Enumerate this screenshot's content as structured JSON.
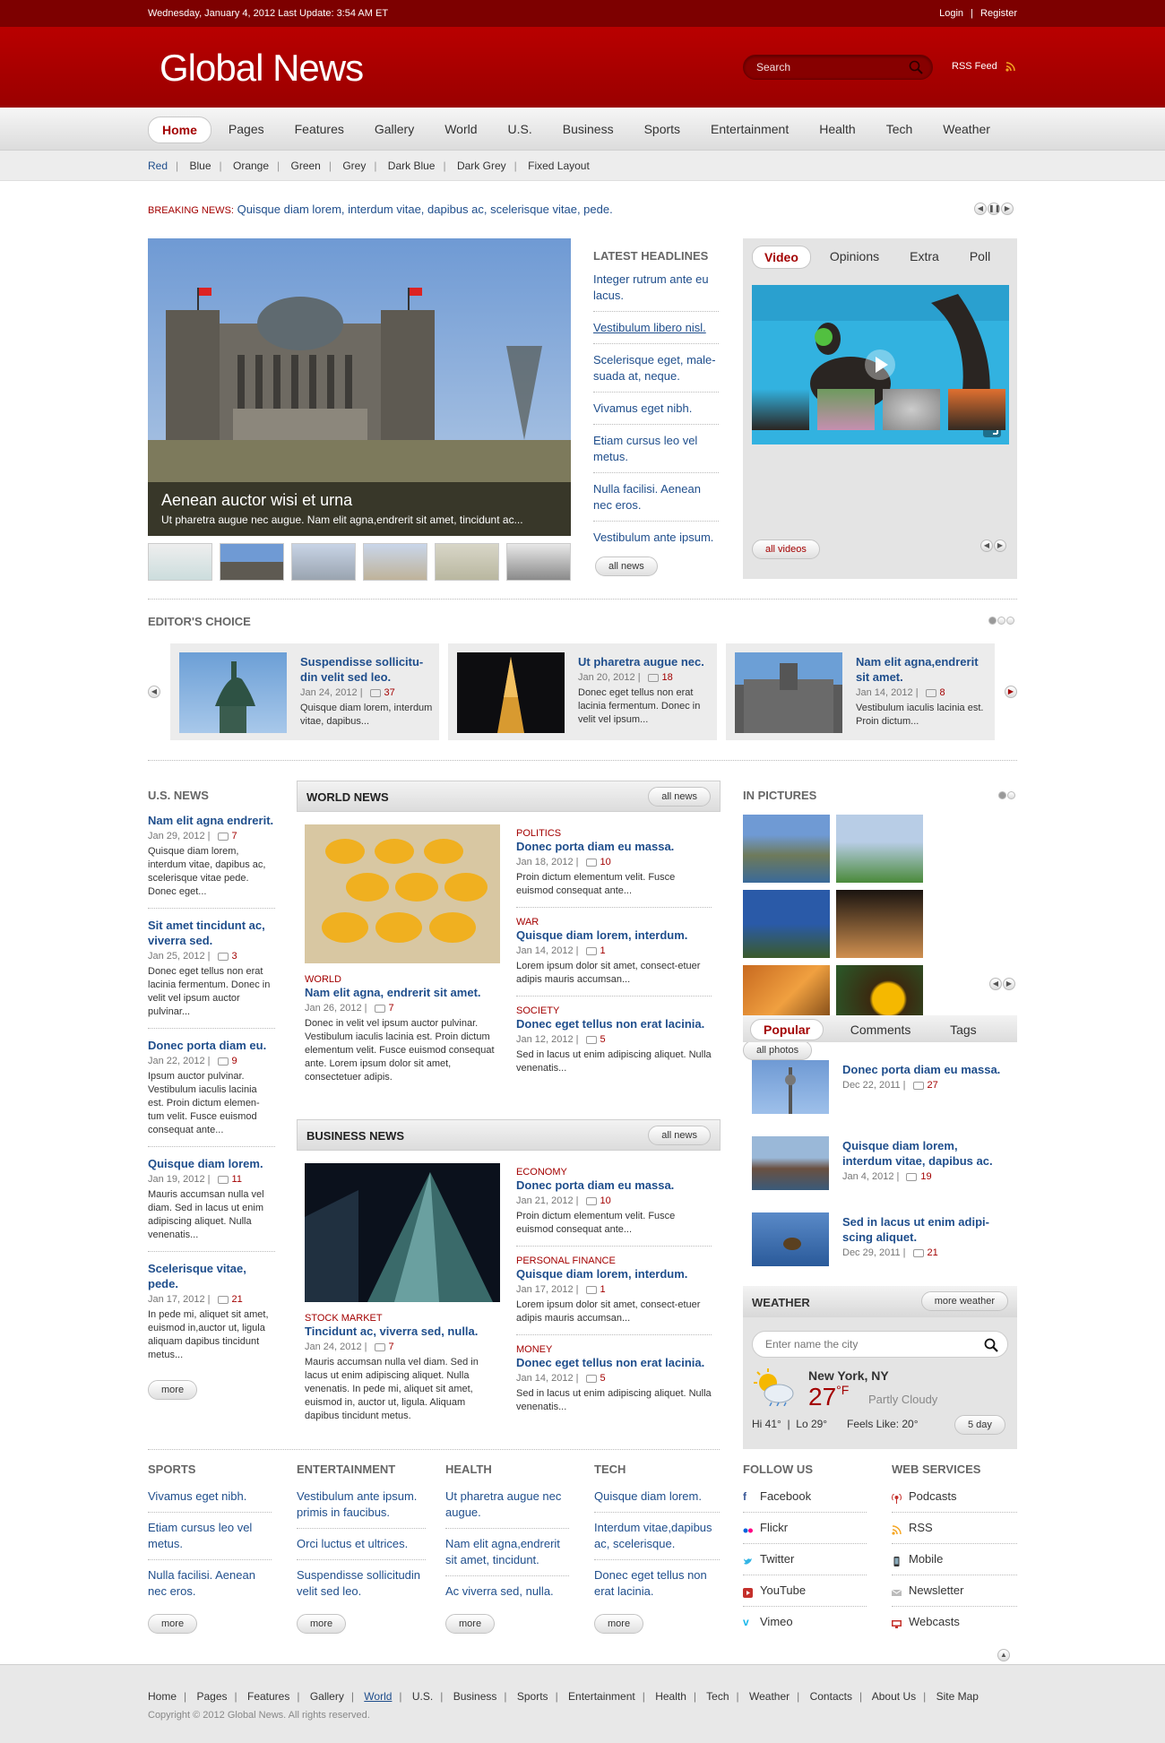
{
  "topbar": {
    "date": "Wednesday, January 4, 2012  Last Update: 3:54 AM ET",
    "login": "Login",
    "register": "Register",
    "sep": "|"
  },
  "header": {
    "logo": "Global News",
    "search_placeholder": "Search",
    "rss": "RSS Feed"
  },
  "nav": [
    "Home",
    "Pages",
    "Features",
    "Gallery",
    "World",
    "U.S.",
    "Business",
    "Sports",
    "Entertainment",
    "Health",
    "Tech",
    "Weather"
  ],
  "subnav": [
    "Red",
    "Blue",
    "Orange",
    "Green",
    "Grey",
    "Dark Blue",
    "Dark Grey",
    "Fixed Layout"
  ],
  "breaking": {
    "label": "BREAKING NEWS:",
    "text": "Quisque diam lorem, interdum vitae, dapibus ac, scelerisque vitae, pede."
  },
  "hero": {
    "title": "Aenean auctor wisi et urna",
    "subtitle": "Ut pharetra augue nec augue. Nam elit agna,endrerit sit amet, tincidunt ac..."
  },
  "latest": {
    "title": "LATEST HEADLINES",
    "items": [
      "Integer rutrum ante eu lacus.",
      "Vestibulum libero nisl.",
      "Scelerisque eget, male-suada at, neque.",
      "Vivamus eget nibh.",
      "Etiam cursus leo vel metus.",
      "Nulla facilisi. Aenean nec eros.",
      "Vestibulum ante ipsum."
    ],
    "more": "all news"
  },
  "media": {
    "tabs": [
      "Video",
      "Opinions",
      "Extra",
      "Poll"
    ],
    "more": "all videos"
  },
  "editors": {
    "title": "EDITOR'S CHOICE",
    "cards": [
      {
        "title": "Suspendisse sollicitu-din velit sed leo.",
        "date": "Jan 24, 2012",
        "comments": "37",
        "desc": "Quisque diam lorem, interdum vitae, dapibus..."
      },
      {
        "title": "Ut pharetra augue nec.",
        "date": "Jan 20, 2012",
        "comments": "18",
        "desc": "Donec eget tellus non erat lacinia fermentum. Donec in velit vel ipsum..."
      },
      {
        "title": "Nam elit agna,endrerit sit amet.",
        "date": "Jan 14, 2012",
        "comments": "8",
        "desc": "Vestibulum iaculis lacinia est. Proin dictum..."
      }
    ]
  },
  "usnews": {
    "title": "U.S. NEWS",
    "items": [
      {
        "title": "Nam elit agna endrerit.",
        "date": "Jan 29, 2012",
        "comments": "7",
        "desc": "Quisque diam lorem, interdum vitae, dapibus ac, scelerisque vitae pede. Donec eget..."
      },
      {
        "title": "Sit amet tincidunt ac, viverra sed.",
        "date": "Jan 25, 2012",
        "comments": "3",
        "desc": "Donec eget tellus non erat lacinia fermentum. Donec in velit vel ipsum auctor pulvinar..."
      },
      {
        "title": "Donec porta diam eu.",
        "date": "Jan 22, 2012",
        "comments": "9",
        "desc": "Ipsum auctor pulvinar. Vestibulum iaculis lacinia est. Proin dictum elemen-tum velit. Fusce euismod consequat ante..."
      },
      {
        "title": "Quisque diam lorem.",
        "date": "Jan 19, 2012",
        "comments": "11",
        "desc": "Mauris accumsan nulla vel diam. Sed in lacus ut enim adipiscing aliquet. Nulla venenatis..."
      },
      {
        "title": "Scelerisque vitae, pede.",
        "date": "Jan 17, 2012",
        "comments": "21",
        "desc": "In pede mi, aliquet sit amet, euismod in,auctor ut, ligula aliquam dapibus tincidunt metus..."
      }
    ],
    "more": "more"
  },
  "world": {
    "title": "WORLD NEWS",
    "more": "all news",
    "lead": {
      "cat": "WORLD",
      "title": "Nam elit agna, endrerit sit amet.",
      "date": "Jan 26, 2012",
      "comments": "7",
      "desc": "Donec in velit vel ipsum auctor pulvinar. Vestibulum iaculis lacinia est. Proin dictum elementum velit. Fusce euismod consequat ante. Lorem ipsum dolor sit amet, consectetuer adipis."
    },
    "items": [
      {
        "cat": "POLITICS",
        "title": "Donec porta diam eu massa.",
        "date": "Jan 18, 2012",
        "comments": "10",
        "desc": "Proin dictum elementum velit. Fusce euismod consequat ante..."
      },
      {
        "cat": "WAR",
        "title": "Quisque diam lorem, interdum.",
        "date": "Jan 14, 2012",
        "comments": "1",
        "desc": "Lorem ipsum dolor sit amet, consect-etuer adipis mauris accumsan..."
      },
      {
        "cat": "SOCIETY",
        "title": "Donec eget tellus non erat lacinia.",
        "date": "Jan 12, 2012",
        "comments": "5",
        "desc": "Sed in lacus ut enim adipiscing aliquet. Nulla venenatis..."
      }
    ]
  },
  "business": {
    "title": "BUSINESS NEWS",
    "more": "all news",
    "lead": {
      "cat": "STOCK MARKET",
      "title": "Tincidunt ac, viverra sed, nulla.",
      "date": "Jan 24, 2012",
      "comments": "7",
      "desc": "Mauris accumsan nulla vel diam. Sed in lacus ut enim adipiscing aliquet. Nulla venenatis. In pede mi, aliquet sit amet, euismod in, auctor ut, ligula. Aliquam dapibus tincidunt metus."
    },
    "items": [
      {
        "cat": "ECONOMY",
        "title": "Donec porta diam eu massa.",
        "date": "Jan 21, 2012",
        "comments": "10",
        "desc": "Proin dictum elementum velit. Fusce euismod consequat ante..."
      },
      {
        "cat": "PERSONAL FINANCE",
        "title": "Quisque diam lorem, interdum.",
        "date": "Jan 17, 2012",
        "comments": "1",
        "desc": "Lorem ipsum dolor sit amet, consect-etuer adipis mauris accumsan..."
      },
      {
        "cat": "MONEY",
        "title": "Donec eget tellus non erat lacinia.",
        "date": "Jan 14, 2012",
        "comments": "5",
        "desc": "Sed in lacus ut enim adipiscing aliquet. Nulla venenatis..."
      }
    ]
  },
  "pictures": {
    "title": "IN PICTURES",
    "more": "all photos"
  },
  "popular": {
    "tabs": [
      "Popular",
      "Comments",
      "Tags"
    ],
    "items": [
      {
        "title": "Donec porta diam eu massa.",
        "date": "Dec 22, 2011",
        "comments": "27"
      },
      {
        "title": "Quisque diam lorem, interdum vitae, dapibus ac.",
        "date": "Jan 4, 2012",
        "comments": "19"
      },
      {
        "title": "Sed in lacus ut enim adipi-scing aliquet.",
        "date": "Dec 29, 2011",
        "comments": "21"
      }
    ]
  },
  "weather": {
    "title": "WEATHER",
    "more": "more weather",
    "placeholder": "Enter name the city",
    "city": "New York, NY",
    "temp": "27",
    "unit": "°F",
    "cond": "Partly Cloudy",
    "hilo": "Hi 41°  |  Lo 29°",
    "feels": "Feels Like: 20°",
    "fiveday": "5 day"
  },
  "bottom": {
    "sports": {
      "title": "SPORTS",
      "links": [
        "Vivamus eget nibh.",
        "Etiam cursus leo vel metus.",
        "Nulla facilisi. Aenean nec eros."
      ]
    },
    "entertainment": {
      "title": "ENTERTAINMENT",
      "links": [
        "Vestibulum ante ipsum. primis in faucibus.",
        "Orci luctus et ultrices.",
        "Suspendisse sollicitudin velit sed leo."
      ]
    },
    "health": {
      "title": "HEALTH",
      "links": [
        "Ut pharetra augue nec augue.",
        "Nam elit agna,endrerit sit amet, tincidunt.",
        "Ac viverra sed, nulla."
      ]
    },
    "tech": {
      "title": "TECH",
      "links": [
        "Quisque diam lorem.",
        "Interdum vitae,dapibus ac, scelerisque.",
        "Donec eget tellus non erat lacinia."
      ]
    },
    "more": "more",
    "follow": {
      "title": "FOLLOW US",
      "links": [
        "Facebook",
        "Flickr",
        "Twitter",
        "YouTube",
        "Vimeo"
      ]
    },
    "services": {
      "title": "WEB SERVICES",
      "links": [
        "Podcasts",
        "RSS",
        "Mobile",
        "Newsletter",
        "Webcasts"
      ]
    }
  },
  "footer": {
    "links": [
      "Home",
      "Pages",
      "Features",
      "Gallery",
      "World",
      "U.S.",
      "Business",
      "Sports",
      "Entertainment",
      "Health",
      "Tech",
      "Weather",
      "Contacts",
      "About Us",
      "Site Map"
    ],
    "copyright": "Copyright © 2012 Global News. All rights reserved."
  },
  "colors": {
    "brand": "#a30000",
    "link": "#1f4e8c"
  }
}
